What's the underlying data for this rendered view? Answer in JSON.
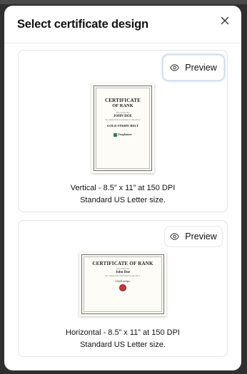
{
  "modal": {
    "title": "Select certificate design",
    "close_icon": "close-icon"
  },
  "options": [
    {
      "preview_label": "Preview",
      "preview_icon": "eye-icon",
      "line1": "Vertical - 8.5” x 11” at 150 DPI",
      "line2": "Standard US Letter size.",
      "certificate": {
        "title": "CERTIFICATE",
        "title2": "OF RANK",
        "awarded_to_text": "This certifies that",
        "name": "JOHN DOE",
        "body_text": "has completed the requirements for the rank of",
        "rank": "GOLD STRIPE BELT",
        "logo_text": "Zenplanner"
      }
    },
    {
      "preview_label": "Preview",
      "preview_icon": "eye-icon",
      "line1": "Horizontal -  8.5” x 11” at 150 DPI",
      "line2": "Standard US Letter size.",
      "certificate": {
        "title": "CERTIFICATE OF RANK",
        "awarded_to_text": "This certifies that",
        "name": "John Doe",
        "body_text": "has completed the requirements for the rank of",
        "rank": "Gold stripe"
      }
    }
  ]
}
